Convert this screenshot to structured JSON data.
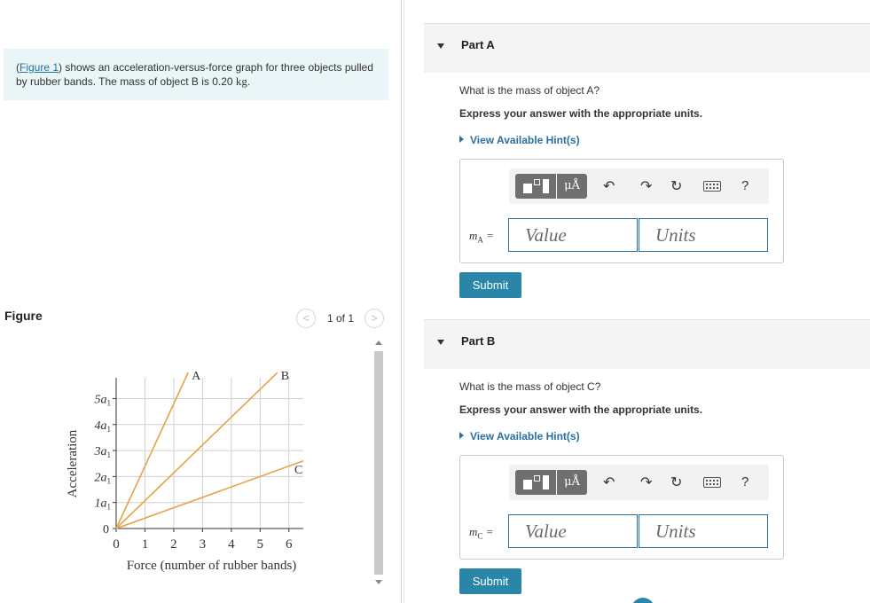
{
  "intro": {
    "figure_link": "Figure 1",
    "text_before": "(",
    "text_after": ") shows an acceleration-versus-force graph for three objects pulled by rubber bands. The mass of object B is 0.20 ",
    "unit": "kg",
    "text_end": "."
  },
  "figure": {
    "title": "Figure",
    "pager": {
      "prev": "<",
      "count": "1 of 1",
      "next": ">"
    }
  },
  "chart_data": {
    "type": "line",
    "xlabel": "Force (number of rubber bands)",
    "ylabel": "Acceleration",
    "x_ticks": [
      "0",
      "1",
      "2",
      "3",
      "4",
      "5",
      "6"
    ],
    "y_ticks": [
      "0",
      "1a",
      "2a",
      "3a",
      "4a",
      "5a"
    ],
    "y_tick_subscript": "1",
    "xlim": [
      0,
      6.5
    ],
    "ylim": [
      0,
      5.8
    ],
    "grid": true,
    "series": [
      {
        "name": "A",
        "x": [
          0,
          2.5
        ],
        "y": [
          0,
          6.0
        ],
        "color": "#e8a247"
      },
      {
        "name": "B",
        "x": [
          0,
          5.6
        ],
        "y": [
          0,
          6.0
        ],
        "color": "#e8a247"
      },
      {
        "name": "C",
        "x": [
          0,
          6.5
        ],
        "y": [
          0,
          2.6
        ],
        "color": "#e8a247"
      }
    ]
  },
  "partA": {
    "title": "Part A",
    "question": "What is the mass of object A?",
    "instruction": "Express your answer with the appropriate units.",
    "hint": "View Available Hint(s)",
    "variable": "m",
    "variable_sub": "A",
    "equals": "=",
    "value_placeholder": "Value",
    "units_placeholder": "Units",
    "submit": "Submit"
  },
  "partB": {
    "title": "Part B",
    "question": "What is the mass of object C?",
    "instruction": "Express your answer with the appropriate units.",
    "hint": "View Available Hint(s)",
    "variable": "m",
    "variable_sub": "C",
    "equals": "=",
    "value_placeholder": "Value",
    "units_placeholder": "Units",
    "submit": "Submit"
  },
  "toolbar": {
    "units_label": "μÅ",
    "undo": "↶",
    "redo": "↷",
    "reset": "↻",
    "help": "?"
  },
  "colors": {
    "accent": "#2a86a8",
    "link": "#2a6fa0",
    "intro_bg": "#e9f5f6",
    "line": "#e8a247"
  }
}
